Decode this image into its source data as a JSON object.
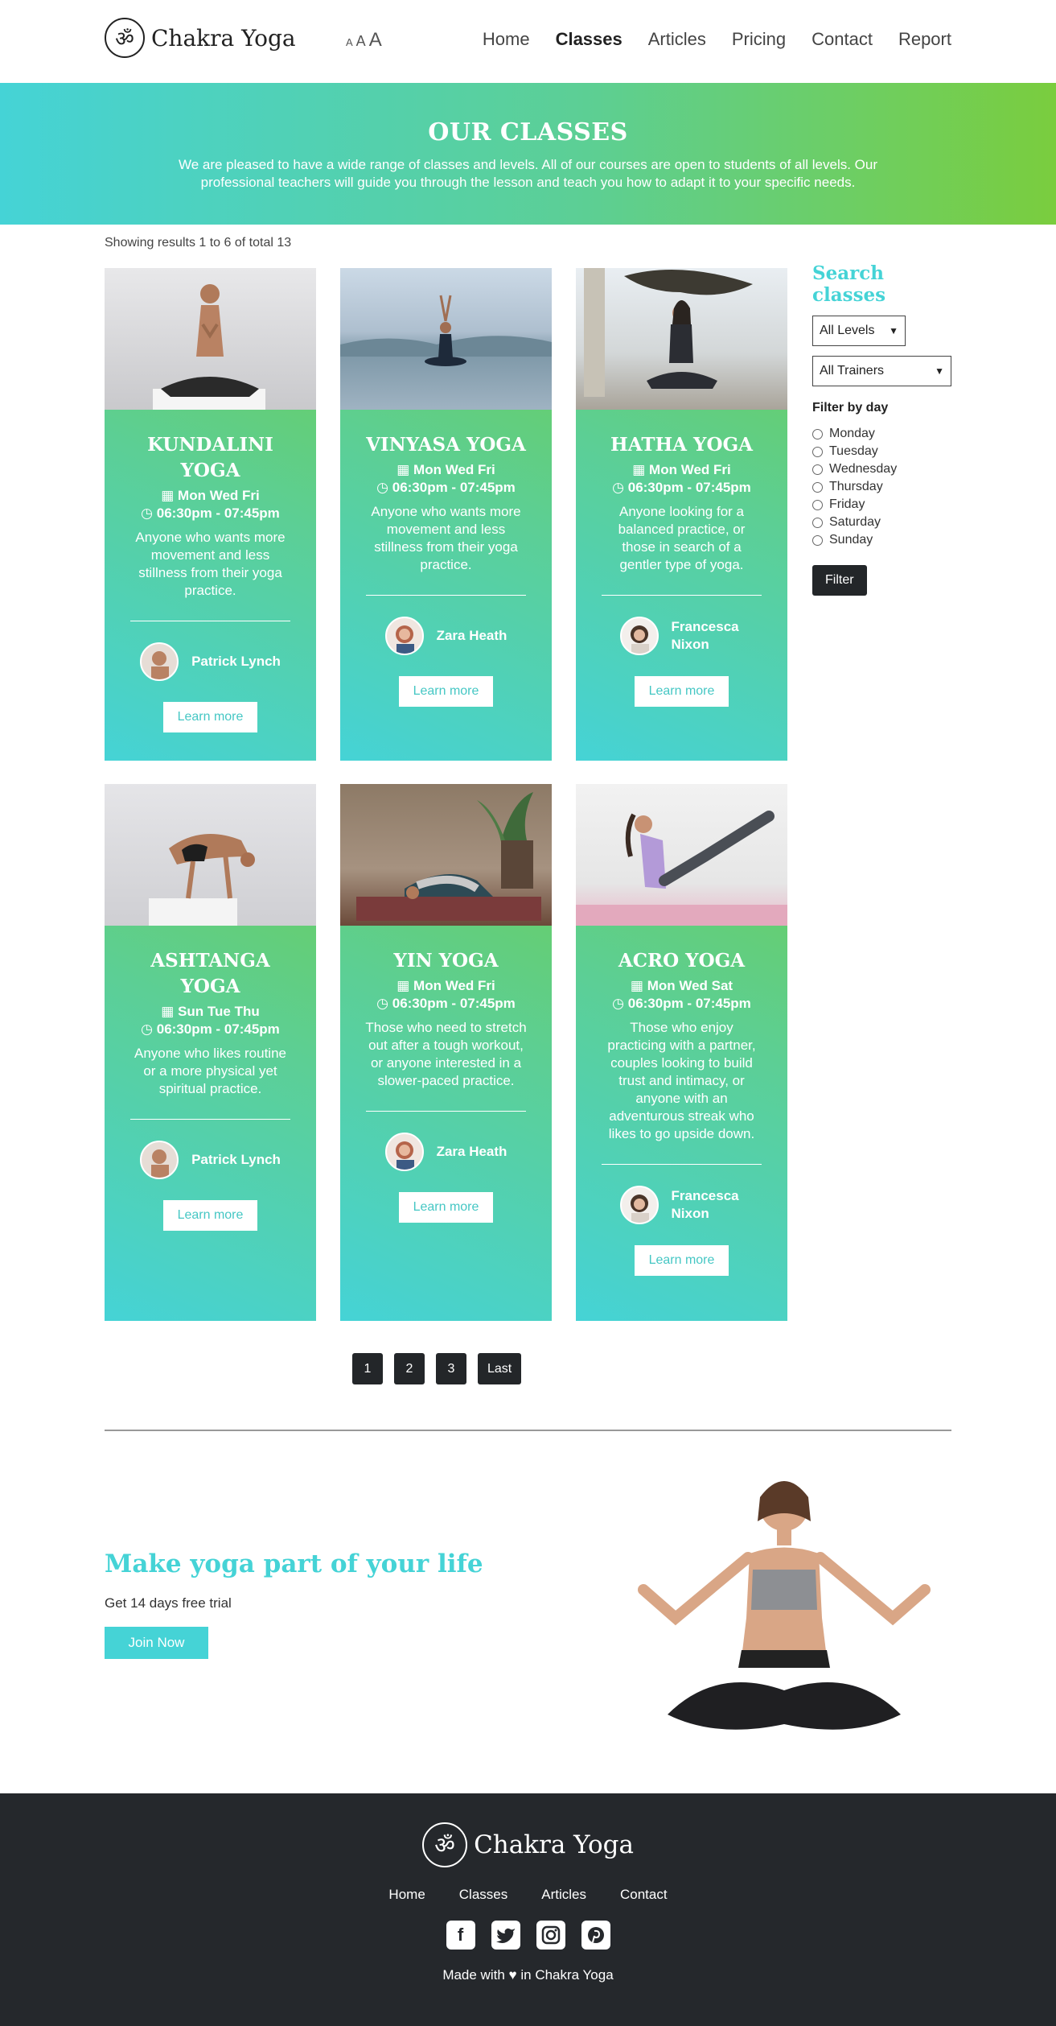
{
  "brand": {
    "name": "Chakra Yoga",
    "logo_glyph": "ॐ"
  },
  "font_controls": [
    "A",
    "A",
    "A"
  ],
  "nav": [
    "Home",
    "Classes",
    "Articles",
    "Pricing",
    "Contact",
    "Report"
  ],
  "hero": {
    "title": "OUR CLASSES",
    "text": "We are pleased to have a wide range of classes and levels. All of our courses are open to students of all levels. Our professional teachers will guide you through the lesson and teach you how to adapt it to your specific needs."
  },
  "results": "Showing results 1 to 6 of total 13",
  "cards": [
    {
      "title": "KUNDALINI YOGA",
      "days": "Mon Wed Fri",
      "time": "06:30pm - 07:45pm",
      "desc": "Anyone who wants more movement and less stillness from their yoga practice.",
      "trainer": "Patrick Lynch",
      "cta": "Learn more"
    },
    {
      "title": "VINYASA YOGA",
      "days": "Mon Wed Fri",
      "time": "06:30pm - 07:45pm",
      "desc": "Anyone who wants more movement and less stillness from their yoga practice.",
      "trainer": "Zara Heath",
      "cta": "Learn more"
    },
    {
      "title": "HATHA YOGA",
      "days": "Mon Wed Fri",
      "time": "06:30pm - 07:45pm",
      "desc": "Anyone looking for a balanced practice, or those in search of a gentler type of yoga.",
      "trainer": "Francesca Nixon",
      "cta": "Learn more"
    },
    {
      "title": "ASHTANGA YOGA",
      "days": "Sun Tue Thu",
      "time": "06:30pm - 07:45pm",
      "desc": "Anyone who likes routine or a more physical yet spiritual practice.",
      "trainer": "Patrick Lynch",
      "cta": "Learn more"
    },
    {
      "title": "YIN YOGA",
      "days": "Mon Wed Fri",
      "time": "06:30pm - 07:45pm",
      "desc": "Those who need to stretch out after a tough workout, or anyone interested in a slower-paced practice.",
      "trainer": "Zara Heath",
      "cta": "Learn more"
    },
    {
      "title": "ACRO YOGA",
      "days": "Mon Wed Sat",
      "time": "06:30pm - 07:45pm",
      "desc": "Those who enjoy practicing with a partner, couples looking to build trust and intimacy, or anyone with an adventurous streak who likes to go upside down.",
      "trainer": "Francesca Nixon",
      "cta": "Learn more"
    }
  ],
  "sidebar": {
    "title": "Search classes",
    "levels": "All Levels",
    "trainers": "All Trainers",
    "filter_by_day": "Filter by day",
    "days": [
      "Monday",
      "Tuesday",
      "Wednesday",
      "Thursday",
      "Friday",
      "Saturday",
      "Sunday"
    ],
    "filter_btn": "Filter"
  },
  "pagination": [
    "1",
    "2",
    "3",
    "Last"
  ],
  "cta": {
    "title": "Make yoga part of your life",
    "subtitle": "Get 14 days free trial",
    "button": "Join Now"
  },
  "footer": {
    "brand": "Chakra Yoga",
    "nav": [
      "Home",
      "Classes",
      "Articles",
      "Contact"
    ],
    "made_prefix": "Made with",
    "made_suffix": "in Chakra Yoga"
  },
  "colors": {
    "accent": "#45d3d6",
    "green": "#7acd3e",
    "dark": "#25282c"
  }
}
